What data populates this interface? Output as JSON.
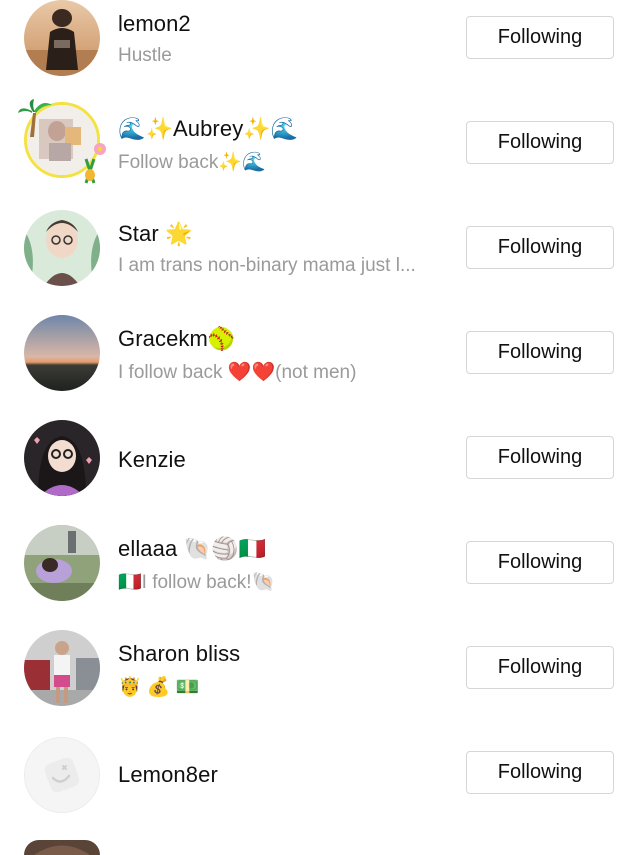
{
  "following_list": {
    "button_label": "Following",
    "users": [
      {
        "name": "lemon2",
        "bio": "Hustle"
      },
      {
        "name": "🌊✨Aubrey✨🌊",
        "bio": "Follow back✨🌊"
      },
      {
        "name": "Star 🌟",
        "bio": "I am trans non-binary mama just l..."
      },
      {
        "name": "Gracekm🥎",
        "bio": "I follow back ❤️❤️(not men)"
      },
      {
        "name": "Kenzie",
        "bio": ""
      },
      {
        "name": "ellaaa 🐚🏐🇮🇹",
        "bio": "🇮🇹I follow back!🐚"
      },
      {
        "name": "Sharon bliss",
        "bio": "🤴 💰 💵"
      },
      {
        "name": "Lemon8er",
        "bio": ""
      }
    ]
  }
}
